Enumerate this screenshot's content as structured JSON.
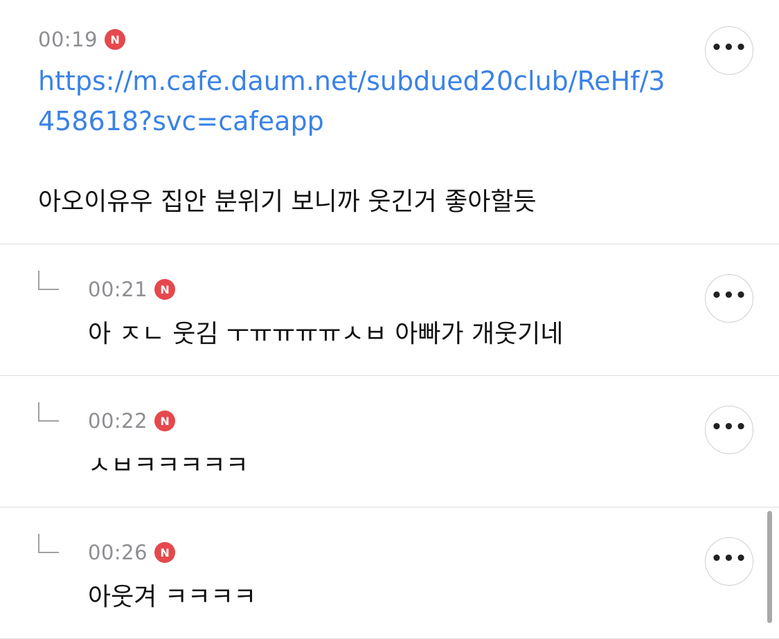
{
  "comments": [
    {
      "time": "00:19",
      "badge": "N",
      "link": "https://m.cafe.daum.net/subdued20club/ReHf/3458618?svc=cafeapp",
      "text": "아오이유우 집안 분위기 보니까 웃긴거 좋아할듯",
      "more_label": "•••"
    },
    {
      "time": "00:21",
      "badge": "N",
      "text": "아 ㅈㄴ 웃김 ㅜㅠㅠㅠㅠㅅㅂ 아빠가 개웃기네",
      "more_label": "•••"
    },
    {
      "time": "00:22",
      "badge": "N",
      "text": "ㅅㅂㅋㅋㅋㅋㅋ",
      "more_label": "•••"
    },
    {
      "time": "00:26",
      "badge": "N",
      "text": "아웃겨 ㅋㅋㅋㅋ",
      "more_label": "•••"
    }
  ],
  "icons": {
    "reply": "reply-arrow-icon",
    "more": "more-dots-icon",
    "new_badge": "new-badge-icon"
  },
  "colors": {
    "link": "#3a82e6",
    "badge": "#e5484d",
    "time": "#8e8e93",
    "divider": "#dcdcdc"
  }
}
